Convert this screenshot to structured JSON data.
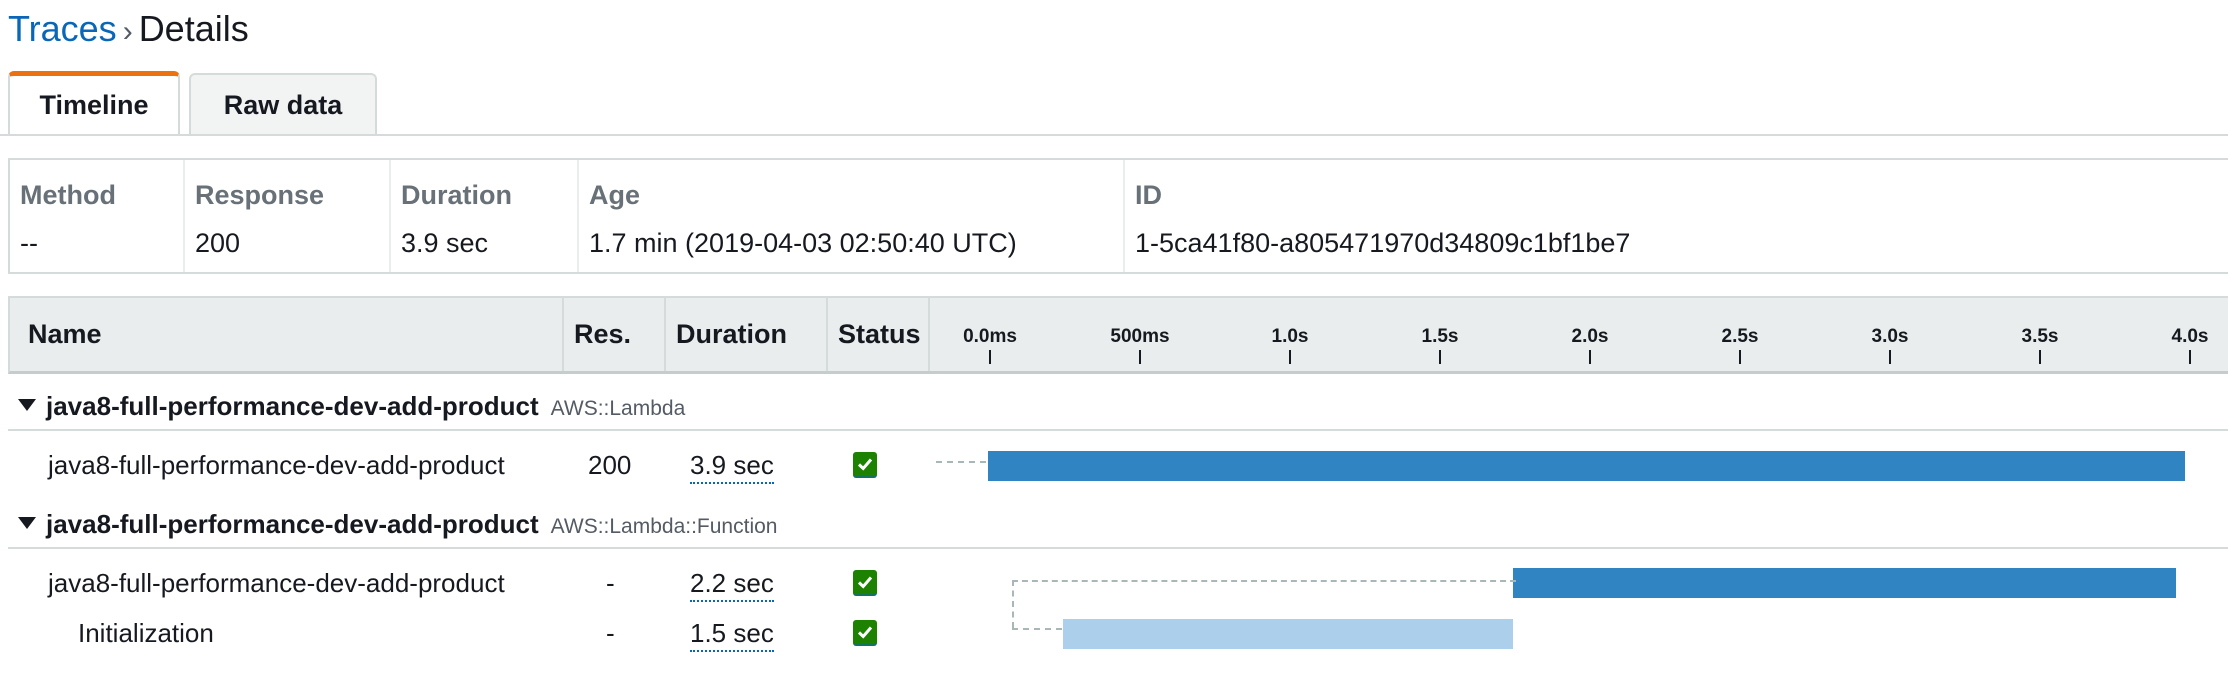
{
  "breadcrumb": {
    "link": "Traces",
    "separator": "›",
    "current": "Details"
  },
  "tabs": [
    {
      "label": "Timeline",
      "active": true
    },
    {
      "label": "Raw data",
      "active": false
    }
  ],
  "summary": {
    "method": {
      "label": "Method",
      "value": "--"
    },
    "response": {
      "label": "Response",
      "value": "200"
    },
    "duration": {
      "label": "Duration",
      "value": "3.9 sec"
    },
    "age": {
      "label": "Age",
      "value": "1.7 min (2019-04-03 02:50:40 UTC)"
    },
    "id": {
      "label": "ID",
      "value": "1-5ca41f80-a805471970d34809c1bf1be7"
    }
  },
  "table": {
    "columns": {
      "name": "Name",
      "res": "Res.",
      "duration": "Duration",
      "status": "Status"
    },
    "timeline_ticks": [
      "0.0ms",
      "500ms",
      "1.0s",
      "1.5s",
      "2.0s",
      "2.5s",
      "3.0s",
      "3.5s",
      "4.0s"
    ],
    "timeline_max_sec": 4.0
  },
  "groups": [
    {
      "name": "java8-full-performance-dev-add-product",
      "type": "AWS::Lambda",
      "segments": [
        {
          "name": "java8-full-performance-dev-add-product",
          "res": "200",
          "duration": "3.9 sec",
          "status": "ok",
          "start_sec": 0.0,
          "end_sec": 3.99
        }
      ]
    },
    {
      "name": "java8-full-performance-dev-add-product",
      "type": "AWS::Lambda::Function",
      "segments": [
        {
          "name": "java8-full-performance-dev-add-product",
          "res": "-",
          "duration": "2.2 sec",
          "status": "ok",
          "start_sec": 1.75,
          "end_sec": 3.96
        },
        {
          "name": "Initialization",
          "res": "-",
          "duration": "1.5 sec",
          "status": "ok",
          "start_sec": 0.25,
          "end_sec": 1.75
        }
      ]
    }
  ],
  "colors": {
    "bar_primary": "#3184c2",
    "bar_secondary": "#acd0eb",
    "status_ok": "#1d8102",
    "tab_accent": "#ec7211",
    "link": "#0a66b7"
  }
}
